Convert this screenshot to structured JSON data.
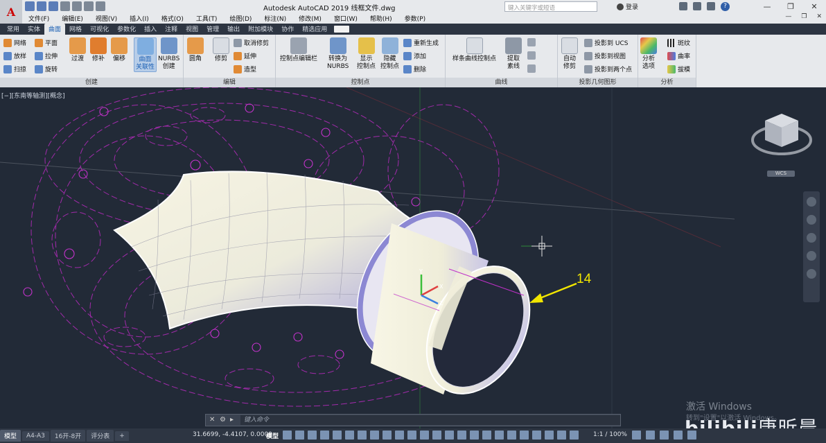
{
  "app": {
    "logo_letter": "A",
    "title": "Autodesk AutoCAD 2019    线框文件.dwg",
    "search_placeholder": "键入关键字或短语",
    "login_label": "登录",
    "help_label": "?",
    "window_controls": [
      "—",
      "❐",
      "✕"
    ],
    "mdi_controls": [
      "—",
      "❐",
      "✕"
    ]
  },
  "menubar": {
    "items": [
      "文件(F)",
      "编辑(E)",
      "视图(V)",
      "插入(I)",
      "格式(O)",
      "工具(T)",
      "绘图(D)",
      "标注(N)",
      "修改(M)",
      "窗口(W)",
      "帮助(H)",
      "参数(P)"
    ]
  },
  "ribbon_tabs": {
    "items": [
      "常用",
      "实体",
      "曲面",
      "网格",
      "可视化",
      "参数化",
      "插入",
      "注释",
      "视图",
      "管理",
      "输出",
      "附加模块",
      "协作",
      "精选应用"
    ],
    "active": "曲面"
  },
  "ribbon": {
    "create": {
      "title": "创建",
      "small": [
        "网络",
        "放样",
        "扫掠",
        "平面",
        "拉伸",
        "旋转"
      ],
      "large": [
        "过渡",
        "修补",
        "偏移"
      ],
      "associativity": [
        "曲面",
        "关联性"
      ],
      "nurbs": [
        "NURBS",
        "创建"
      ]
    },
    "edit": {
      "title": "编辑",
      "large": [
        "圆角",
        "修剪"
      ],
      "small": [
        "取消修剪",
        "延伸",
        "造型"
      ]
    },
    "control_points": {
      "title": "控制点",
      "cv_editbar": "控制点编辑栏",
      "convert": [
        "转换为",
        "NURBS"
      ],
      "show": [
        "显示",
        "控制点"
      ],
      "hide": [
        "隐藏",
        "控制点"
      ],
      "small": [
        "重新生成",
        "添加",
        "删除"
      ]
    },
    "curves": {
      "title": "曲线",
      "spline_cv": "样条曲线控制点",
      "extract": [
        "提取",
        "素线"
      ]
    },
    "project": {
      "title": "投影几何图形",
      "auto_trim": [
        "自动",
        "修剪"
      ],
      "small": [
        "投影到 UCS",
        "投影到视图",
        "投影到两个点"
      ]
    },
    "analysis": {
      "title": "分析",
      "options": [
        "分析",
        "选项"
      ],
      "small": [
        "斑纹",
        "曲率",
        "拔模"
      ]
    }
  },
  "viewport": {
    "label": "[−][东南等轴测][概念]",
    "annotation_number": "14",
    "wcs_label": "WCS",
    "ucs_axes": [
      "X",
      "Y",
      "Z"
    ]
  },
  "watermark": {
    "activate_line1": "激活 Windows",
    "activate_line2": "转到\"设置\"以激活 Windows。",
    "brand": "bilibili",
    "handle": "唐昕晨"
  },
  "command_line": {
    "placeholder": "键入命令"
  },
  "status": {
    "layout_tabs": [
      "模型",
      "A4-A3",
      "16开-8开",
      "评分表"
    ],
    "add_tab": "+",
    "coords": "31.6699, -4.4107, 0.0000",
    "model_label": "模型",
    "scale": "1:1 / 100%"
  },
  "colors": {
    "background": "#222a37",
    "wireframe": "#c030c8",
    "surface_light": "#f6f3e2",
    "surface_shade": "#9b97d6",
    "annotation": "#f2e600",
    "ribbon_bg": "#e7e9ec"
  }
}
